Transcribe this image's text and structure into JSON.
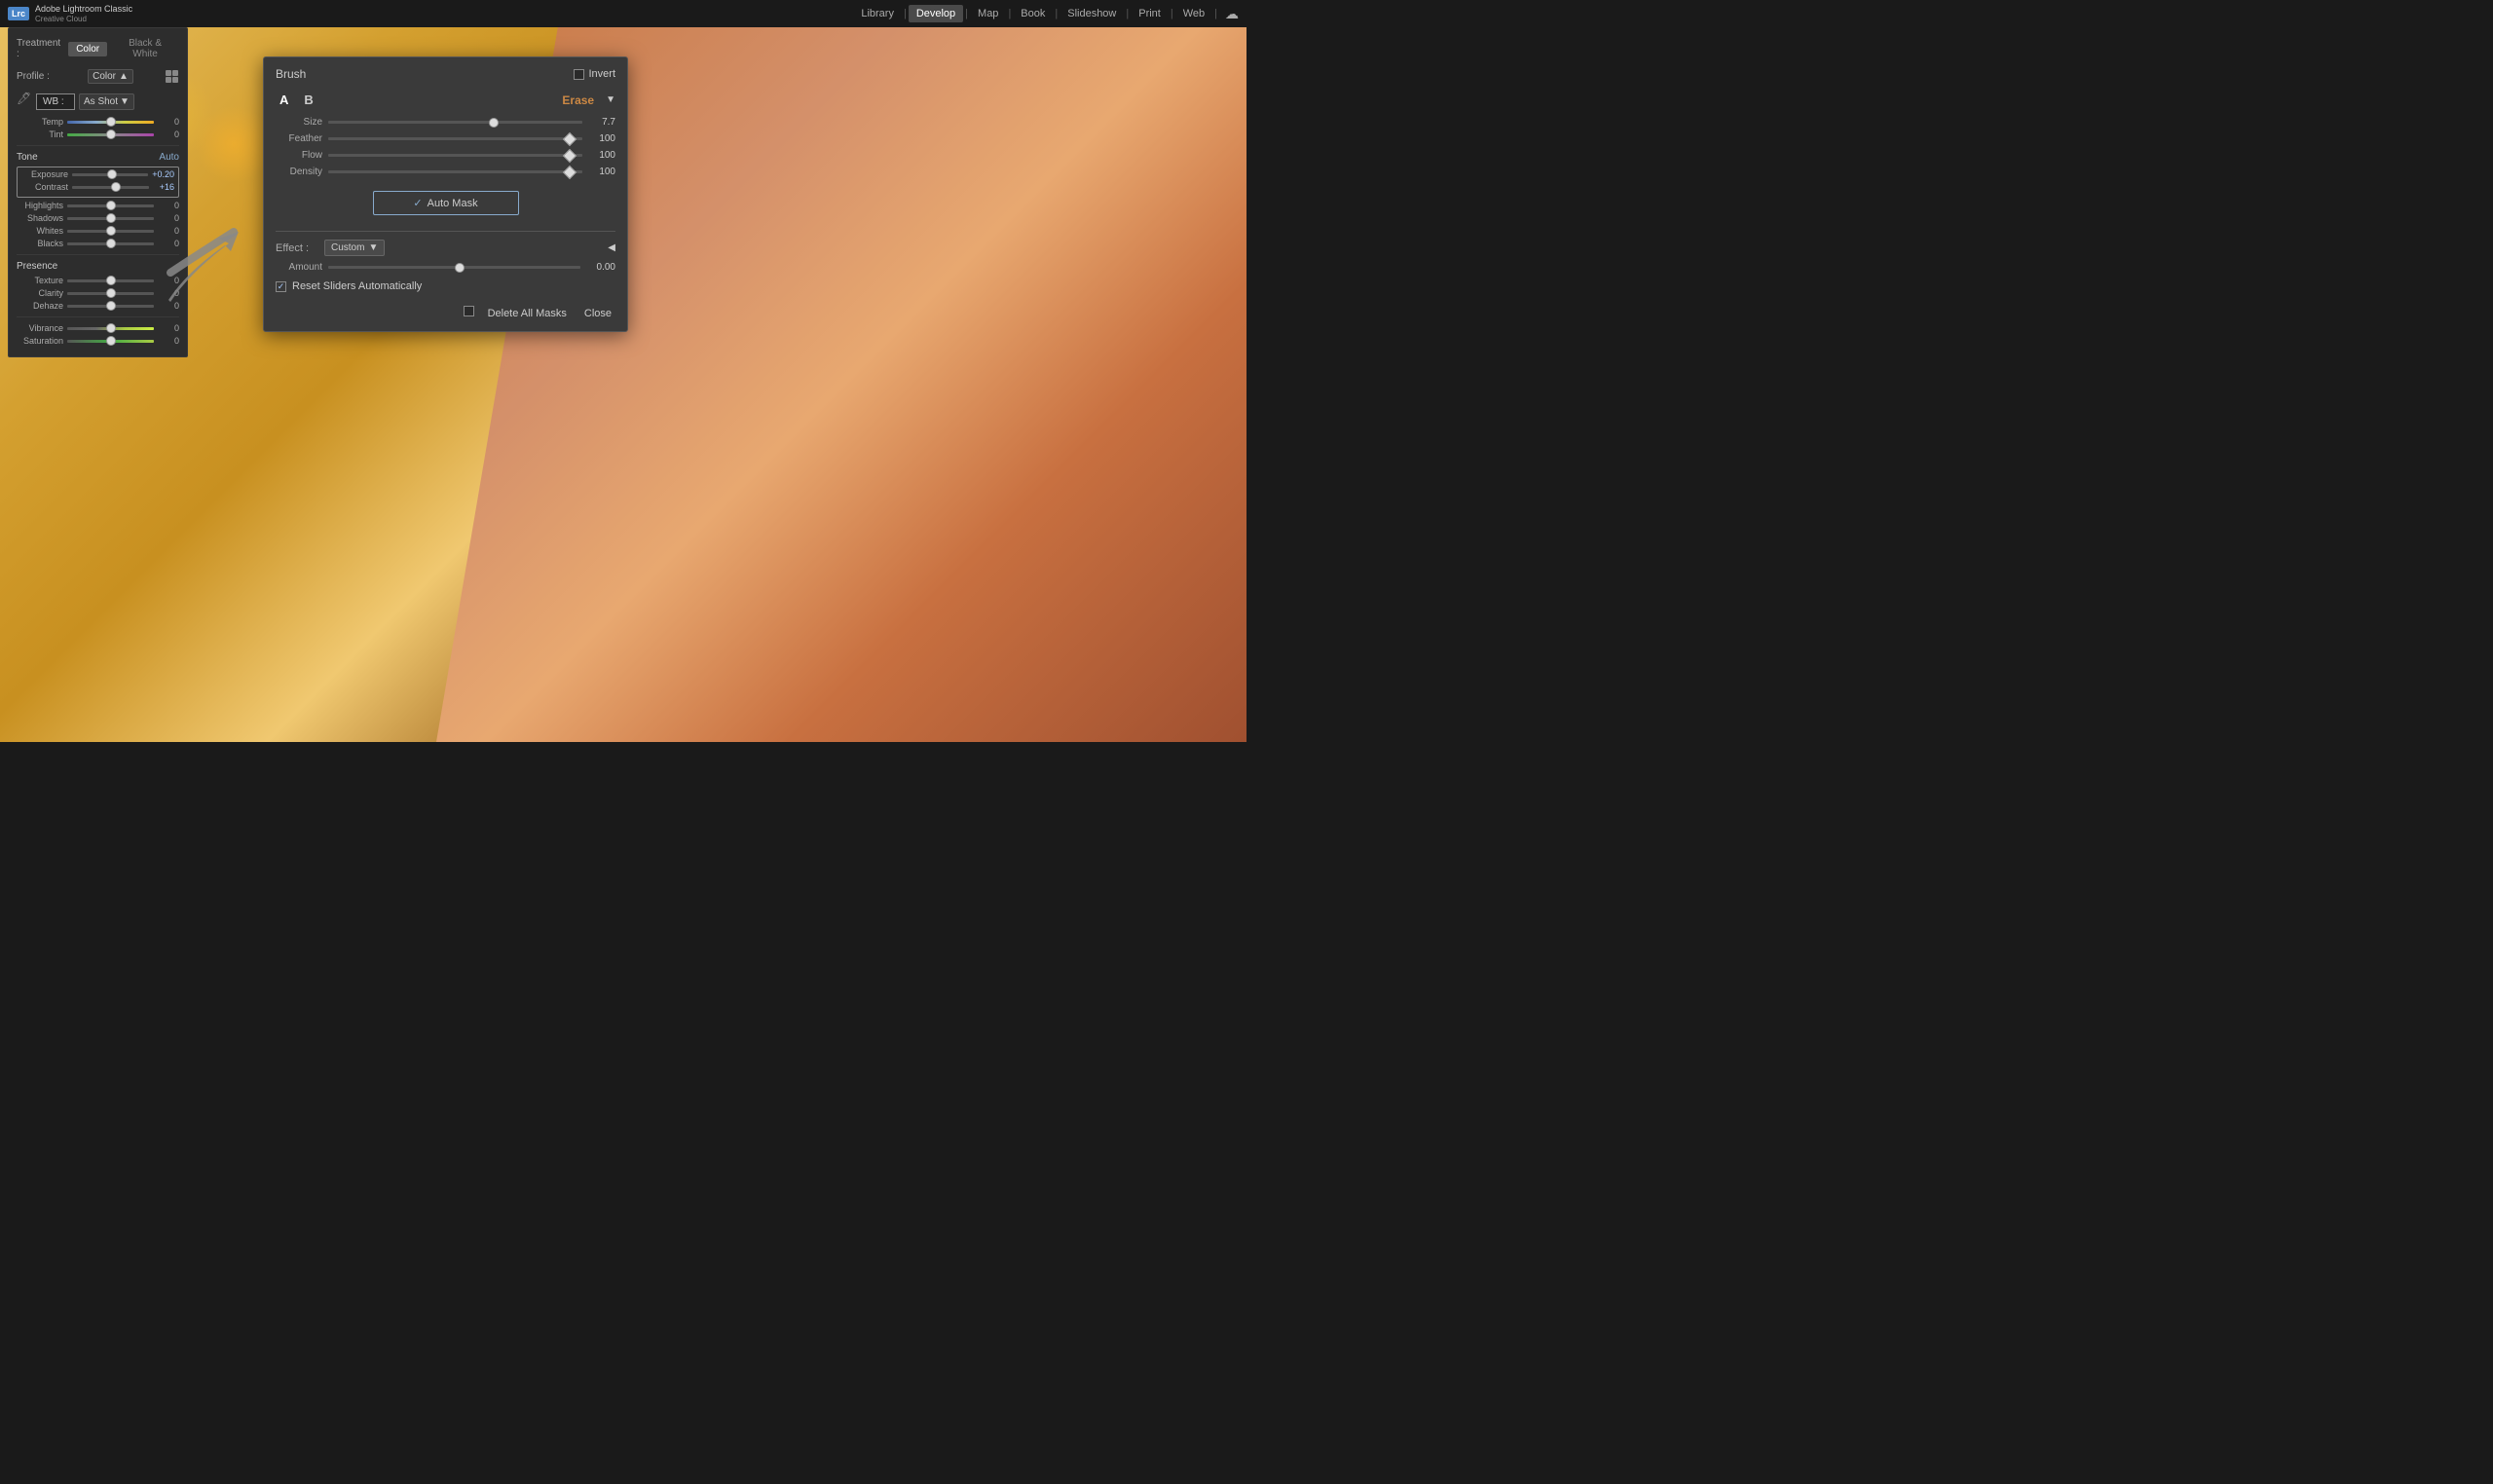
{
  "topbar": {
    "logo_badge": "Lrc",
    "logo_line1": "Adobe Lightroom Classic",
    "logo_line2": "Creative Cloud",
    "nav_items": [
      "Library",
      "Develop",
      "Map",
      "Book",
      "Slideshow",
      "Print",
      "Web"
    ],
    "active_nav": "Develop",
    "cloud_icon": "☁"
  },
  "left_panel": {
    "treatment_label": "Treatment :",
    "treatment_color": "Color",
    "treatment_bw": "Black & White",
    "profile_label": "Profile :",
    "profile_value": "Color",
    "wb_label": "WB :",
    "wb_value": "As Shot",
    "tone_label": "Tone",
    "tone_auto": "Auto",
    "sliders": {
      "temp": {
        "label": "Temp",
        "value": "0",
        "thumb_pct": 50
      },
      "tint": {
        "label": "Tint",
        "value": "0",
        "thumb_pct": 50
      },
      "exposure": {
        "label": "Exposure",
        "value": "+0.20",
        "thumb_pct": 52
      },
      "contrast": {
        "label": "Contrast",
        "value": "+16",
        "thumb_pct": 57
      },
      "highlights": {
        "label": "Highlights",
        "value": "0",
        "thumb_pct": 50
      },
      "shadows": {
        "label": "Shadows",
        "value": "0",
        "thumb_pct": 50
      },
      "whites": {
        "label": "Whites",
        "value": "0",
        "thumb_pct": 50
      },
      "blacks": {
        "label": "Blacks",
        "value": "0",
        "thumb_pct": 50
      }
    },
    "presence_label": "Presence",
    "presence_sliders": {
      "texture": {
        "label": "Texture",
        "value": "0",
        "thumb_pct": 50
      },
      "clarity": {
        "label": "Clarity",
        "value": "0",
        "thumb_pct": 50
      },
      "dehaze": {
        "label": "Dehaze",
        "value": "0",
        "thumb_pct": 50
      },
      "vibrance": {
        "label": "Vibrance",
        "value": "0",
        "thumb_pct": 50
      },
      "saturation": {
        "label": "Saturation",
        "value": "0",
        "thumb_pct": 50
      }
    }
  },
  "brush_panel": {
    "title": "Brush",
    "invert_label": "Invert",
    "tab_a": "A",
    "tab_b": "B",
    "erase_label": "Erase",
    "size_label": "Size",
    "size_value": "7.7",
    "size_pct": 65,
    "feather_label": "Feather",
    "feather_value": "100",
    "feather_pct": 95,
    "flow_label": "Flow",
    "flow_value": "100",
    "flow_pct": 95,
    "density_label": "Density",
    "density_value": "100",
    "density_pct": 95,
    "auto_mask_label": "Auto Mask",
    "effect_label": "Effect :",
    "effect_value": "Custom",
    "amount_label": "Amount",
    "amount_value": "0.00",
    "amount_pct": 50,
    "reset_label": "Reset Sliders Automatically",
    "delete_masks_label": "Delete All Masks",
    "close_label": "Close"
  }
}
